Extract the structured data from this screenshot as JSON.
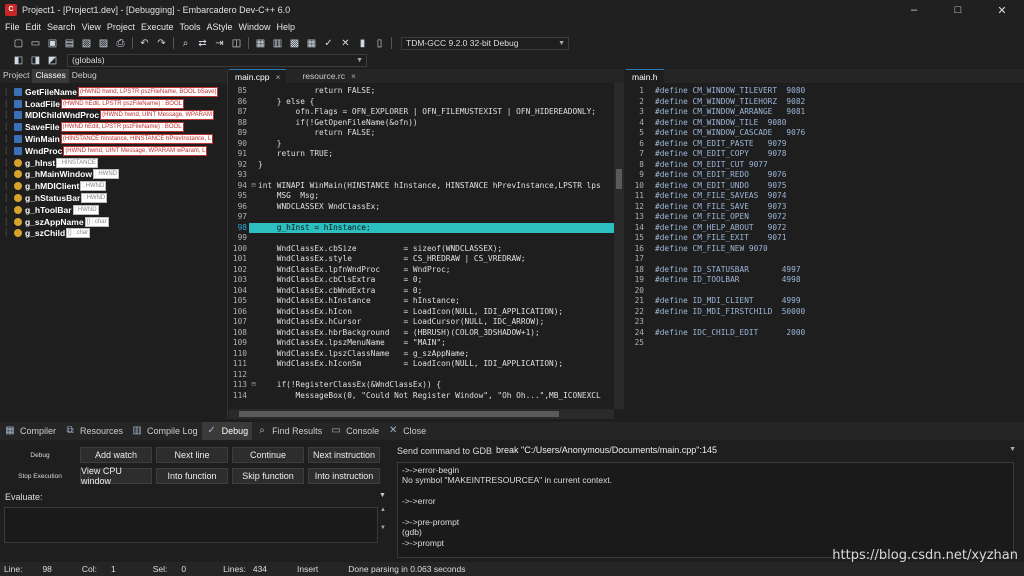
{
  "window": {
    "app_icon": "devcpp-icon",
    "title": "Project1 - [Project1.dev] - [Debugging] - Embarcadero Dev-C++ 6.0",
    "controls": [
      "–",
      "□",
      "✕"
    ]
  },
  "menu": [
    "File",
    "Edit",
    "Search",
    "View",
    "Project",
    "Execute",
    "Tools",
    "AStyle",
    "Window",
    "Help"
  ],
  "toolbar": {
    "compiler": "TDM-GCC 9.2.0 32-bit Debug",
    "scope": "(globals)"
  },
  "left_panel": {
    "tabs": [
      "Project",
      "Classes",
      "Debug"
    ],
    "active_tab": "Classes",
    "items": [
      {
        "name": "GetFileName",
        "sig": "(HWND hwnd, LPSTR pszFileName, BOOL bSave)",
        "kind": "function"
      },
      {
        "name": "LoadFile",
        "sig": "(HWND hEdit, LPSTR pszFileName) : BOOL",
        "kind": "function"
      },
      {
        "name": "MDIChildWndProc",
        "sig": "(HWND hwnd, UINT Message, WPARAM",
        "kind": "function"
      },
      {
        "name": "SaveFile",
        "sig": "(HWND hEdit, LPSTR pszFileName) : BOOL",
        "kind": "function"
      },
      {
        "name": "WinMain",
        "sig": "(HINSTANCE hInstance, HINSTANCE hPrevInstance, L",
        "kind": "function"
      },
      {
        "name": "WndProc",
        "sig": "(HWND hwnd, UINT Message, WPARAM wParam, L",
        "kind": "function"
      },
      {
        "name": "g_hInst",
        "sig": ": HINSTANCE",
        "kind": "variable"
      },
      {
        "name": "g_hMainWindow",
        "sig": ": HWND",
        "kind": "variable"
      },
      {
        "name": "g_hMDIClient",
        "sig": ": HWND",
        "kind": "variable"
      },
      {
        "name": "g_hStatusBar",
        "sig": ": HWND",
        "kind": "variable"
      },
      {
        "name": "g_hToolBar",
        "sig": ": HWND",
        "kind": "variable"
      },
      {
        "name": "g_szAppName",
        "sig": "[] : char",
        "kind": "variable"
      },
      {
        "name": "g_szChild",
        "sig": "[] : char",
        "kind": "variable"
      }
    ]
  },
  "editor1": {
    "tabs": [
      "main.cpp",
      "resource.rc"
    ],
    "active_tab": "main.cpp",
    "highlighted_line": "98",
    "lines": [
      {
        "n": "85",
        "f": "",
        "t": "            return FALSE;"
      },
      {
        "n": "86",
        "f": "",
        "t": "    } else {"
      },
      {
        "n": "87",
        "f": "",
        "t": "        ofn.Flags = OFN_EXPLORER | OFN_FILEMUSTEXIST | OFN_HIDEREADONLY;"
      },
      {
        "n": "88",
        "f": "",
        "t": "        if(!GetOpenFileName(&ofn))"
      },
      {
        "n": "89",
        "f": "",
        "t": "            return FALSE;"
      },
      {
        "n": "90",
        "f": "",
        "t": "    }"
      },
      {
        "n": "91",
        "f": "",
        "t": "    return TRUE;"
      },
      {
        "n": "92",
        "f": "",
        "t": "}"
      },
      {
        "n": "93",
        "f": "",
        "t": ""
      },
      {
        "n": "94",
        "f": "⊟",
        "t": "int WINAPI WinMain(HINSTANCE hInstance, HINSTANCE hPrevInstance,LPSTR lps"
      },
      {
        "n": "95",
        "f": "",
        "t": "    MSG  Msg;"
      },
      {
        "n": "96",
        "f": "",
        "t": "    WNDCLASSEX WndClassEx;"
      },
      {
        "n": "97",
        "f": "",
        "t": ""
      },
      {
        "n": "98",
        "f": "",
        "t": "    g_hInst = hInstance;"
      },
      {
        "n": "99",
        "f": "",
        "t": ""
      },
      {
        "n": "100",
        "f": "",
        "t": "    WndClassEx.cbSize          = sizeof(WNDCLASSEX);"
      },
      {
        "n": "101",
        "f": "",
        "t": "    WndClassEx.style           = CS_HREDRAW | CS_VREDRAW;"
      },
      {
        "n": "102",
        "f": "",
        "t": "    WndClassEx.lpfnWndProc     = WndProc;"
      },
      {
        "n": "103",
        "f": "",
        "t": "    WndClassEx.cbClsExtra      = 0;"
      },
      {
        "n": "104",
        "f": "",
        "t": "    WndClassEx.cbWndExtra      = 0;"
      },
      {
        "n": "105",
        "f": "",
        "t": "    WndClassEx.hInstance       = hInstance;"
      },
      {
        "n": "106",
        "f": "",
        "t": "    WndClassEx.hIcon           = LoadIcon(NULL, IDI_APPLICATION);"
      },
      {
        "n": "107",
        "f": "",
        "t": "    WndClassEx.hCursor         = LoadCursor(NULL, IDC_ARROW);"
      },
      {
        "n": "108",
        "f": "",
        "t": "    WndClassEx.hbrBackground   = (HBRUSH)(COLOR_3DSHADOW+1);"
      },
      {
        "n": "109",
        "f": "",
        "t": "    WndClassEx.lpszMenuName    = \"MAIN\";"
      },
      {
        "n": "110",
        "f": "",
        "t": "    WndClassEx.lpszClassName   = g_szAppName;"
      },
      {
        "n": "111",
        "f": "",
        "t": "    WndClassEx.hIconSm         = LoadIcon(NULL, IDI_APPLICATION);"
      },
      {
        "n": "112",
        "f": "",
        "t": ""
      },
      {
        "n": "113",
        "f": "⊟",
        "t": "    if(!RegisterClassEx(&WndClassEx)) {"
      },
      {
        "n": "114",
        "f": "",
        "t": "        MessageBox(0, \"Could Not Register Window\", \"Oh Oh...\",MB_ICONEXCL"
      }
    ]
  },
  "editor2": {
    "tabs": [
      "main.h"
    ],
    "active_tab": "main.h",
    "lines": [
      {
        "n": "1",
        "t": "#define CM_WINDOW_TILEVERT  9080"
      },
      {
        "n": "2",
        "t": "#define CM_WINDOW_TILEHORZ  9082"
      },
      {
        "n": "3",
        "t": "#define CM_WINDOW_ARRANGE   9081"
      },
      {
        "n": "4",
        "t": "#define CM_WINDOW_TILE  9080"
      },
      {
        "n": "5",
        "t": "#define CM_WINDOW_CASCADE   9076"
      },
      {
        "n": "6",
        "t": "#define CM_EDIT_PASTE   9079"
      },
      {
        "n": "7",
        "t": "#define CM_EDIT_COPY    9078"
      },
      {
        "n": "8",
        "t": "#define CM_EDIT_CUT 9077"
      },
      {
        "n": "9",
        "t": "#define CM_EDIT_REDO    9076"
      },
      {
        "n": "10",
        "t": "#define CM_EDIT_UNDO    9075"
      },
      {
        "n": "11",
        "t": "#define CM_FILE_SAVEAS  9074"
      },
      {
        "n": "12",
        "t": "#define CM_FILE_SAVE    9073"
      },
      {
        "n": "13",
        "t": "#define CM_FILE_OPEN    9072"
      },
      {
        "n": "14",
        "t": "#define CM_HELP_ABOUT   9072"
      },
      {
        "n": "15",
        "t": "#define CM_FILE_EXIT    9071"
      },
      {
        "n": "16",
        "t": "#define CM_FILE_NEW 9070"
      },
      {
        "n": "17",
        "t": ""
      },
      {
        "n": "18",
        "t": "#define ID_STATUSBAR       4997"
      },
      {
        "n": "19",
        "t": "#define ID_TOOLBAR         4998"
      },
      {
        "n": "20",
        "t": ""
      },
      {
        "n": "21",
        "t": "#define ID_MDI_CLIENT      4999"
      },
      {
        "n": "22",
        "t": "#define ID_MDI_FIRSTCHILD  50000"
      },
      {
        "n": "23",
        "t": ""
      },
      {
        "n": "24",
        "t": "#define IDC_CHILD_EDIT      2000"
      },
      {
        "n": "25",
        "t": ""
      }
    ]
  },
  "bottom_tabs": [
    {
      "label": "Compiler",
      "icon": "grid-icon"
    },
    {
      "label": "Resources",
      "icon": "resources-icon"
    },
    {
      "label": "Compile Log",
      "icon": "chart-icon"
    },
    {
      "label": "Debug",
      "icon": "check-icon"
    },
    {
      "label": "Find Results",
      "icon": "find-icon"
    },
    {
      "label": "Console",
      "icon": "console-icon"
    },
    {
      "label": "Close",
      "icon": "close-icon"
    }
  ],
  "active_bottom_tab": "Debug",
  "debug": {
    "row1_label": "Debug",
    "row2_label": "Stop Execution",
    "row1_buttons": [
      "Add watch",
      "Next line",
      "Continue",
      "Next instruction"
    ],
    "row2_buttons": [
      "View CPU window",
      "Into function",
      "Skip function",
      "Into instruction"
    ],
    "evaluate_label": "Evaluate:",
    "evaluate_value": ""
  },
  "gdb": {
    "label": "Send command to GDB:",
    "command": "break \"C:/Users/Anonymous/Documents/main.cpp\":145",
    "output": [
      "->->error-begin",
      "No symbol \"MAKEINTRESOURCEA\" in current context.",
      "",
      "->->error",
      "",
      "->->pre-prompt",
      "(gdb)",
      "->->prompt"
    ]
  },
  "status": {
    "line_label": "Line:",
    "line": "98",
    "col_label": "Col:",
    "col": "1",
    "sel_label": "Sel:",
    "sel": "0",
    "lines_label": "Lines:",
    "lines": "434",
    "mode": "Insert",
    "message": "Done parsing in 0.063 seconds"
  },
  "watermark": "https://blog.csdn.net/xyzhan",
  "colors": {
    "highlight_line": "#2bbfbf",
    "background": "#1e1e1e",
    "signature_text": "#c23030"
  }
}
